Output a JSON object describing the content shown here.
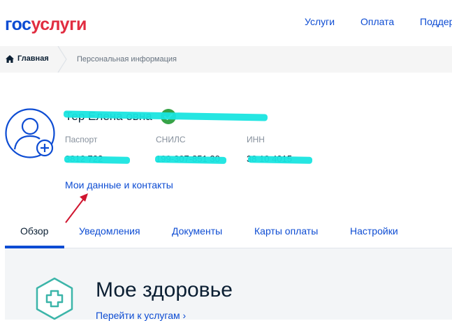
{
  "header": {
    "logo_part1": "гос",
    "logo_part2": "услуги",
    "nav": [
      "Услуги",
      "Оплата",
      "Поддержка"
    ]
  },
  "breadcrumb": {
    "home": "Главная",
    "current": "Персональная информация"
  },
  "profile": {
    "name": "Тер                  Елена                   овна",
    "verified": true,
    "documents": [
      {
        "label": "Паспорт",
        "value": "3812 722                "
      },
      {
        "label": "СНИЛС",
        "value": "199-307-851 30"
      },
      {
        "label": "ИНН",
        "value": "38          10 4015"
      }
    ],
    "my_data_link": "Мои данные и контакты"
  },
  "tabs": [
    "Обзор",
    "Уведомления",
    "Документы",
    "Карты оплаты",
    "Настройки"
  ],
  "active_tab": "Обзор",
  "health": {
    "title": "Мое здоровье",
    "link": "Перейти к услугам",
    "chevron": "›"
  },
  "colors": {
    "brand_blue": "#0d4cd3",
    "brand_red": "#e12d41",
    "verified_green": "#36a347",
    "redaction": "#19e5e0",
    "annotation_arrow": "#d0152f",
    "health_teal": "#3cb5a9"
  },
  "icons": [
    "home-icon",
    "user-avatar-icon",
    "verified-check-icon",
    "medical-cross-icon",
    "chevron-right-icon"
  ]
}
